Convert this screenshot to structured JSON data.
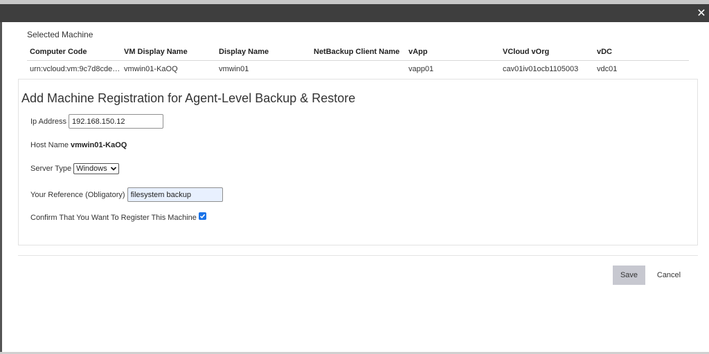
{
  "dialog": {
    "close_icon": "close-icon"
  },
  "selected_machine": {
    "label": "Selected Machine",
    "columns": [
      "Computer Code",
      "VM Display Name",
      "Display Name",
      "NetBackup Client Name",
      "vApp",
      "VCloud vOrg",
      "vDC"
    ],
    "row": [
      "urn:vcloud:vm:9c7d8cde-…",
      "vmwin01-KaOQ",
      "vmwin01",
      "",
      "vapp01",
      "cav01iv01ocb1105003",
      "vdc01"
    ]
  },
  "form": {
    "title": "Add Machine Registration for Agent-Level Backup & Restore",
    "ip_label": "Ip Address",
    "ip_value": "192.168.150.12",
    "host_label": "Host Name",
    "host_value": "vmwin01-KaOQ",
    "server_type_label": "Server Type",
    "server_type_value": "Windows",
    "reference_label": "Your Reference (Obligatory)",
    "reference_value": "filesystem backup",
    "confirm_label": "Confirm That You Want To Register This Machine",
    "confirm_checked": true
  },
  "actions": {
    "save_label": "Save",
    "cancel_label": "Cancel"
  },
  "colors": {
    "titlebar": "#3e3e3e",
    "save_button": "#c7c8d0",
    "checkbox": "#1a73e8",
    "autofill_input": "#e8f0fe"
  }
}
